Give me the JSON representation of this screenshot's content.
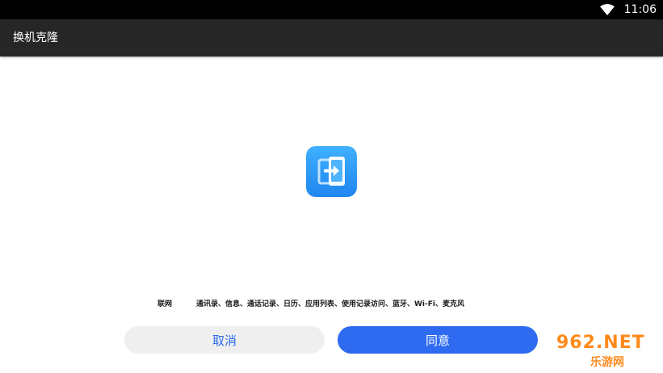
{
  "status_bar": {
    "time": "11:06",
    "wifi_icon": "wifi-icon"
  },
  "app_bar": {
    "title": "换机克隆"
  },
  "logo": {
    "icon": "phone-clone-logo-icon",
    "color": "#2a9df4"
  },
  "permissions": {
    "label": "联网",
    "list": "通讯录、信息、通话记录、日历、应用列表、使用记录访问、蓝牙、Wi-Fi、麦克风"
  },
  "buttons": {
    "cancel_label": "取消",
    "agree_label": "同意",
    "accent": "#2e6bf1"
  },
  "watermark": {
    "top_text": "962.NET",
    "bottom_text": "乐游网"
  }
}
